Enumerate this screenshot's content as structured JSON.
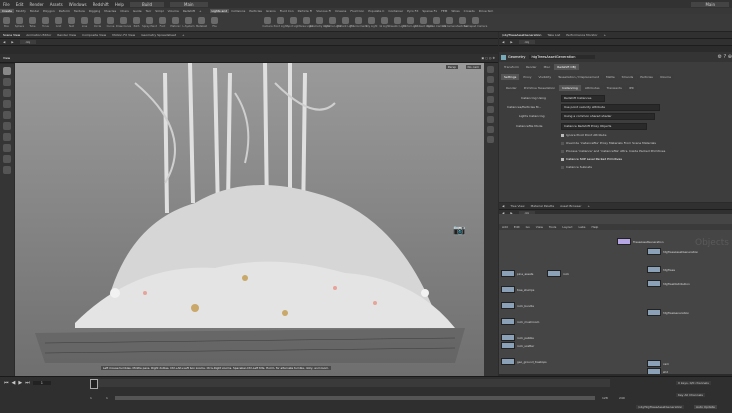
{
  "menu": [
    "File",
    "Edit",
    "Render",
    "Assets",
    "Windows",
    "Redshift",
    "Help"
  ],
  "build_label": "Build",
  "desktop_label": "Main",
  "right_desktop_label": "Main",
  "shelf_tabs": [
    "Create",
    "Modify",
    "Model",
    "Polygon",
    "Deform",
    "Texture",
    "Rigging",
    "Muscles",
    "Chars",
    "Guide",
    "Terr",
    "Simpl",
    "Volume",
    "Redshift",
    "+"
  ],
  "right_shelf_tabs": [
    "Lights and",
    "Collisions",
    "Particles",
    "Grains",
    "Fluid Con",
    "Particle Fl",
    "Viscous Fl",
    "Oceans",
    "Fluid Con",
    "Populate C",
    "Container",
    "Pyro FX",
    "Sparse Fx",
    "FEM",
    "Wires",
    "Crowds",
    "Drive Sim"
  ],
  "shelf_tools": [
    "Box",
    "Sphere",
    "Tube",
    "Torus",
    "Grid",
    "Null",
    "Line",
    "Circle",
    "Curve",
    "Draw Curve",
    "Path",
    "Spray Paint",
    "Font",
    "Platonic",
    "L-System",
    "Metaball",
    "File"
  ],
  "right_shelf_tools": [
    "Camera",
    "Point Light",
    "Spot Light",
    "Area Light",
    "Geometry Light",
    "Volume Light",
    "Distant Light",
    "Environment",
    "Sky Light",
    "GI Light",
    "Caustic Light",
    "Portal Light",
    "Ambient Light",
    "Stereo Camera",
    "VR Camera",
    "Switcher",
    "Gamepad Camera"
  ],
  "left_pane_tabs": [
    "Scene View",
    "Animation Editor",
    "Render View",
    "Composite View",
    "Motion FX View",
    "Geometry Spreadsheet",
    "+"
  ],
  "right_pane_tabs": [
    "/obj/TreesAssetGeneration",
    "Take List",
    "Performance Monitor",
    "+"
  ],
  "path_obj": "obj",
  "view_label": "View",
  "view_cam_label": "Persp",
  "view_nocam": "No cam",
  "viewport_hint": "Left mouse tumbles. Middle pans. Right dollies. Ctrl+Alt+Left box zooms. Ctrl+Right zooms. Spacebar-Ctrl-Left tilts. Hold L for alternate tumble, dolly, and zoom.",
  "geo_title": "Geometry",
  "geo_name": "htgTreesAssetGeneration",
  "param_tabs1": [
    "Transform",
    "Render",
    "Misc",
    "Redshift OBJ"
  ],
  "param_tabs2": [
    "Settings",
    "Proxy",
    "Visibility",
    "Tessellation / Displacement",
    "Matte",
    "Strands",
    "Particles",
    "Volume"
  ],
  "param_tabs3": [
    "Render",
    "Primitive Tessellation",
    "Instancing",
    "Attributes",
    "Transients",
    "IPR"
  ],
  "params": {
    "instancing_label": "Instancing Using",
    "instancing_value": "Redshift Instances",
    "instances_label": "Instances/Particles M...",
    "instances_value": "Use point velocity attribute",
    "lights_label": "Lights Instancing",
    "lights_value": "Using a common shared shader",
    "instancefile_label": "Instancefile Mode",
    "instancefile_value": "Instance Redshift Proxy Objects",
    "check1": "Ignore Pivot Point Attribute",
    "check2": "Override 'instancefile' Proxy Materials From Scene Materials",
    "check3": "Process 'instance' and 'instancefile' Attrs. Inside Packed Primitives",
    "check4": "Instance SOP Level Packed Primitives",
    "check5": "Instance Subnets"
  },
  "net_tabs": [
    "Tree View",
    "Material Palette",
    "Asset Browser",
    "+"
  ],
  "net_path": "obj",
  "net_menu": [
    "Add",
    "Edit",
    "Go",
    "View",
    "Tools",
    "Layout",
    "Labs",
    "Help"
  ],
  "net_watermark": "Objects",
  "nodes": [
    {
      "label": "TreesAssetGeneration"
    },
    {
      "label": "htgTreesAssetGeneration"
    },
    {
      "label": "htgTrees"
    },
    {
      "label": "htgTreeDistribution"
    },
    {
      "label": "htgTreeGeneration"
    },
    {
      "label": "pine_assets"
    },
    {
      "label": "tree_stumps"
    },
    {
      "label": "rock"
    },
    {
      "label": "rock_bundle"
    },
    {
      "label": "rock_mushroom"
    },
    {
      "label": "rock_pebble"
    },
    {
      "label": "rock_scatter"
    },
    {
      "label": "geo_ground_treetops"
    },
    {
      "label": "cam"
    },
    {
      "label": "shd"
    }
  ],
  "timeline": {
    "frame": "1",
    "start": "1",
    "start2": "1",
    "end": "128",
    "end2": "240",
    "keys_label": "0 keys, 0/0 channels",
    "key_all_label": "Key All Channels",
    "auto_update": "Auto Update",
    "status": "/obj/htgTreesAssetGeneration"
  }
}
